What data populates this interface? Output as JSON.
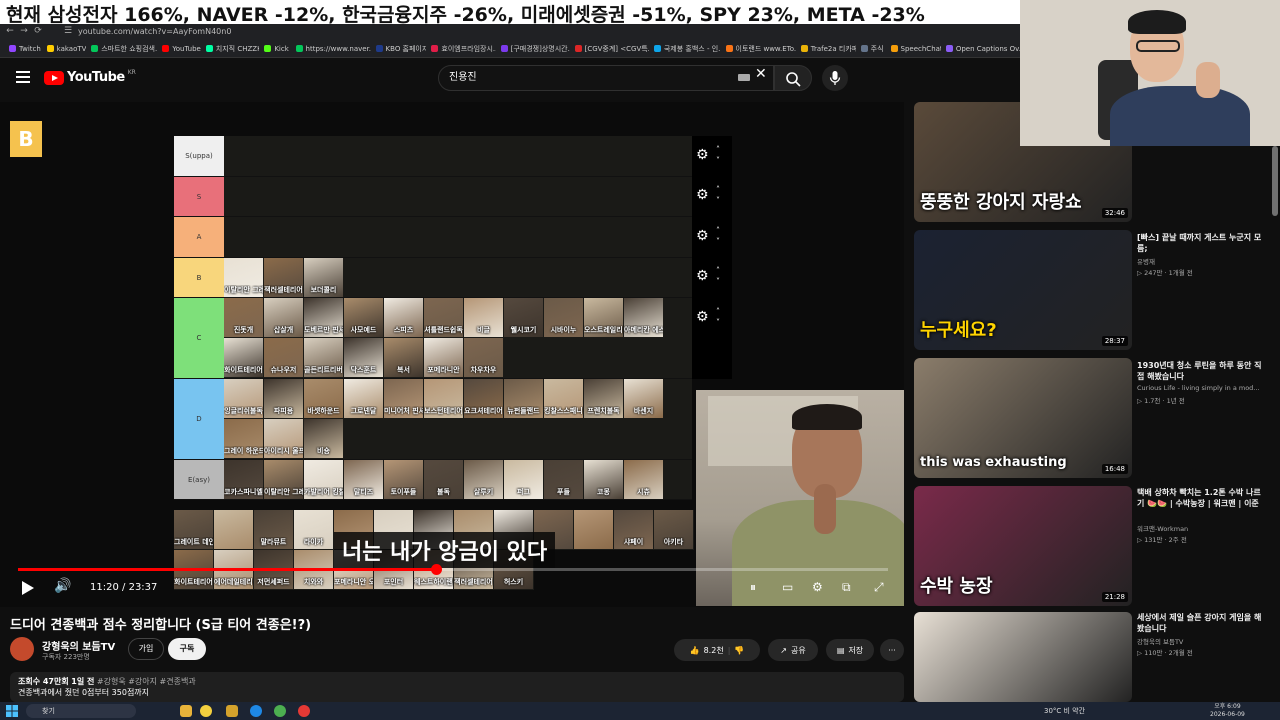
{
  "ticker": {
    "headline": "현재 삼성전자 166%, NAVER -12%, 한국금융지주 -26%, 미래에셋증권 -51%, SPY 23%, META -23%"
  },
  "browser": {
    "url": "youtube.com/watch?v=AayFomN40n0",
    "bookmarks": [
      {
        "label": "Twitch",
        "color": "#9146ff"
      },
      {
        "label": "kakaoTV",
        "color": "#ffcd00"
      },
      {
        "label": "스마트한 쇼핑검색...",
        "color": "#03c75a"
      },
      {
        "label": "YouTube",
        "color": "#ff0000"
      },
      {
        "label": "치지직 CHZZK",
        "color": "#00ffa3"
      },
      {
        "label": "Kick",
        "color": "#53fc18"
      },
      {
        "label": "https://www.naver.c...",
        "color": "#03c75a"
      },
      {
        "label": "KBO 홈페이지",
        "color": "#1e3a8a"
      },
      {
        "label": "효이엠프라임장시...",
        "color": "#e11d48"
      },
      {
        "label": "[구매경쟁]상명시간...",
        "color": "#7c3aed"
      },
      {
        "label": "[CGV중계] <CGV특...",
        "color": "#dc2626"
      },
      {
        "label": "국제봉 홍백스 - 인...",
        "color": "#0ea5e9"
      },
      {
        "label": "이토랜드 www.ETo...",
        "color": "#f97316"
      },
      {
        "label": "Trafe2a 티카페",
        "color": "#eab308"
      },
      {
        "label": "주식",
        "color": "#64748b"
      },
      {
        "label": "SpeechChat",
        "color": "#f59e0b"
      },
      {
        "label": "Open Captions Ov...",
        "color": "#8b5cf6"
      }
    ]
  },
  "youtube": {
    "logo_text": "YouTube",
    "region": "KR",
    "search_value": "진용진"
  },
  "tierlist": {
    "badge": "B",
    "tiers": [
      {
        "label": "S(uppa)",
        "color": "#efefef",
        "dogs": []
      },
      {
        "label": "S",
        "color": "#e8707a",
        "dogs": []
      },
      {
        "label": "A",
        "color": "#f6b07a",
        "dogs": []
      },
      {
        "label": "B",
        "color": "#f8d67c",
        "dogs": [
          "이탈리안 그레이하운드",
          "잭러셀테리어",
          "보더콜리"
        ]
      },
      {
        "label": "C",
        "color": "#7ee07a",
        "dogs": [
          "진돗개",
          "삽살개",
          "도베르만 핀셔",
          "사모예드",
          "스피츠",
          "셔틀랜드쉽독",
          "비글",
          "웰시코기",
          "시바이누",
          "오스트레일리안 셰퍼드",
          "아메리칸 에스키모",
          "화이트테리어",
          "슈나우저",
          "골든리트리버",
          "닥스훈트",
          "복서",
          "포메라니안",
          "차우차우"
        ]
      },
      {
        "label": "D",
        "color": "#78c4f0",
        "dogs": [
          "잉글리쉬불독",
          "파피용",
          "바셋하운드",
          "그로넨달",
          "미니어처 핀셔",
          "보스턴테리어",
          "요크셔테리어",
          "뉴펀들랜드",
          "킹찰스스패니얼",
          "프렌치불독",
          "바센지",
          "그레이 하운드",
          "아이리시 울프하운드",
          "비숑"
        ]
      },
      {
        "label": "E(asy)",
        "color": "#b8b8b8",
        "dogs": [
          "코카스파니엘",
          "이탈리안 그레이하운드",
          "카발리어 킹찰스",
          "말티즈",
          "토이푸들",
          "불독",
          "살루키",
          "퍼그",
          "푸들",
          "코몽",
          "시츄"
        ]
      }
    ],
    "unranked_row1": [
      "그레이트 데인",
      "보스턴",
      "말라뮤트",
      "허스키",
      "라이카",
      "진도",
      "치와와",
      "시바견",
      "포메",
      "말티즈",
      "닥스",
      "불독",
      "골든",
      "비글",
      "셰퍼드",
      "요크셔",
      "리트리버",
      "아키타",
      "샤페이",
      "아키타"
    ],
    "row1_labels": [
      "그레이트 데인",
      "말라뮤트",
      "라이카",
      "샤페이",
      "아키타"
    ],
    "row2_labels": [
      "화이트테리어",
      "에어데일테리어",
      "저먼셰퍼드",
      "치와와",
      "포메라니안 오프스카이",
      "포인터",
      "웨스트하이랜드",
      "잭러셀테리어",
      "허스키"
    ]
  },
  "player": {
    "subtitle": "너는 내가 앙금이 있다",
    "time_current": "11:20",
    "time_total": "23:37",
    "time_separator": "/",
    "progress": 0.48
  },
  "video": {
    "title": "드디어 견종백과 점수 정리합니다 (S급 티어 견종은!?)",
    "channel": "강형욱의 보듬TV",
    "subscribers": "구독자 223만명",
    "join_label": "가입",
    "subscribe_label": "구독",
    "likes": "8.2천",
    "share_label": "공유",
    "save_label": "저장",
    "more_label": "···",
    "views": "조회수 47만회",
    "uploaded": "1일 전",
    "tags": "#강형욱 #강아지 #견종백과",
    "description": "견종백과에서 줬던 0점부터 350점까지"
  },
  "recommendations": [
    {
      "title": "",
      "channel": "",
      "meta": "",
      "duration": "32:46",
      "thumb_text": "뚱뚱한 강아지 자랑쇼",
      "thumb_color": "#5a4a3a"
    },
    {
      "title": "[빠스] 끝날 때까지 게스트 누군지 모름;",
      "channel": "유병재",
      "meta": "▷ 247만 · 1개월 전",
      "duration": "28:37",
      "thumb_text": "누구세요?",
      "thumb_color": "#1b2232"
    },
    {
      "title": "1930년대 청소 루틴을 하루 동안 직접 해봤습니다",
      "channel": "Curious Life - living simply in a mod...",
      "meta": "▷ 1.7천 · 1년 전",
      "duration": "16:48",
      "thumb_text": "this was exhausting",
      "thumb_color": "#8b7d6b"
    },
    {
      "title": "택배 상하차 빡치는 1.2톤 수박 나르기 🍉🍉 | 수박농장 | 워크맨 | 이준",
      "channel": "워크맨-Workman",
      "meta": "▷ 131만 · 2주 전",
      "duration": "21:28",
      "thumb_text": "수박 농장",
      "thumb_color": "#7a2a4a"
    },
    {
      "title": "세상에서 제일 슬픈 강아지 게임을 해봤습니다",
      "channel": "강형욱의 보듬TV",
      "meta": "▷ 110만 · 2개월 전",
      "duration": "",
      "thumb_text": "",
      "thumb_color": "#e8e0d5"
    }
  ],
  "taskbar": {
    "search_label": "찾기",
    "weather": "30°C 비 약간",
    "time": "오후 6:09",
    "date": "2026-06-09"
  }
}
